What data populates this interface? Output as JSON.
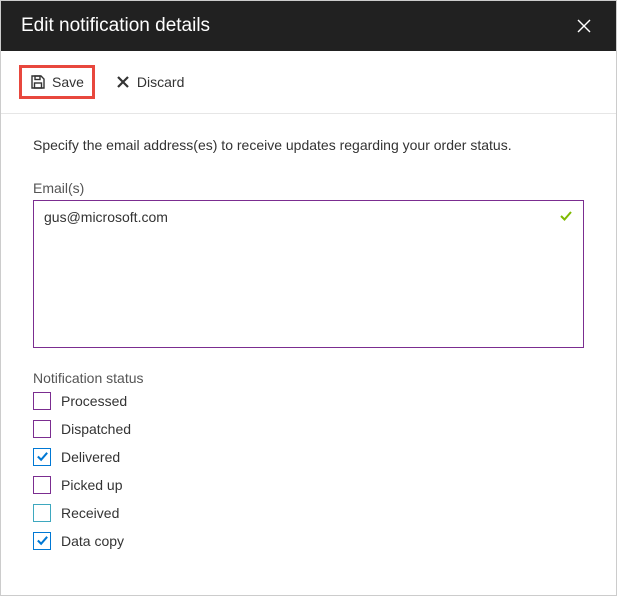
{
  "header": {
    "title": "Edit notification details"
  },
  "toolbar": {
    "save_label": "Save",
    "discard_label": "Discard"
  },
  "instruction": "Specify the email address(es) to receive updates regarding your order status.",
  "emails": {
    "label": "Email(s)",
    "value": "gus@microsoft.com"
  },
  "notification_status": {
    "label": "Notification status",
    "items": [
      {
        "label": "Processed",
        "checked": false,
        "variant": "purple"
      },
      {
        "label": "Dispatched",
        "checked": false,
        "variant": "purple"
      },
      {
        "label": "Delivered",
        "checked": true,
        "variant": "blue"
      },
      {
        "label": "Picked up",
        "checked": false,
        "variant": "purple"
      },
      {
        "label": "Received",
        "checked": false,
        "variant": "teal"
      },
      {
        "label": "Data copy",
        "checked": true,
        "variant": "blue"
      }
    ]
  }
}
